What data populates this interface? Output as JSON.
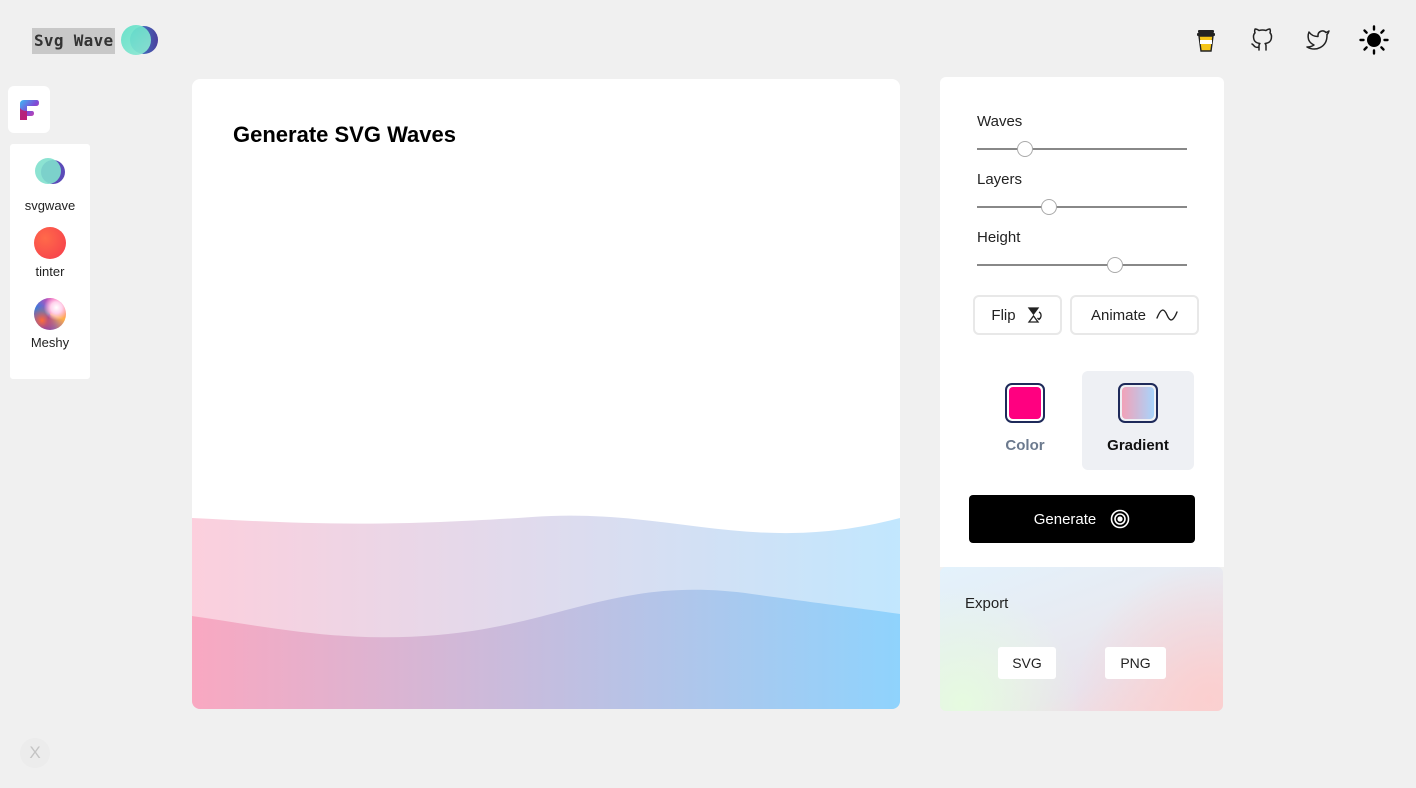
{
  "brand": {
    "title": "Svg Wave"
  },
  "header": {
    "icons": [
      "cup-icon",
      "github-icon",
      "twitter-icon",
      "sun-icon"
    ]
  },
  "sidebar": {
    "items": [
      {
        "label": "svgwave"
      },
      {
        "label": "tinter"
      },
      {
        "label": "Meshy"
      }
    ]
  },
  "preview": {
    "title": "Generate SVG Waves",
    "gradient_start": "#f9a8c1",
    "gradient_end": "#8fd3fd"
  },
  "controls": {
    "sliders": [
      {
        "label": "Waves",
        "value": 0.23
      },
      {
        "label": "Layers",
        "value": 0.345
      },
      {
        "label": "Height",
        "value": 0.655
      }
    ],
    "flip_label": "Flip",
    "animate_label": "Animate",
    "modes": [
      {
        "label": "Color",
        "swatch": "#ff0080",
        "active": false
      },
      {
        "label": "Gradient",
        "swatch": "linear-gradient(90deg,#f2a2b8,#a8d4fb)",
        "active": true
      }
    ],
    "generate_label": "Generate"
  },
  "export": {
    "title": "Export",
    "svg_label": "SVG",
    "png_label": "PNG"
  },
  "close_label": "X"
}
